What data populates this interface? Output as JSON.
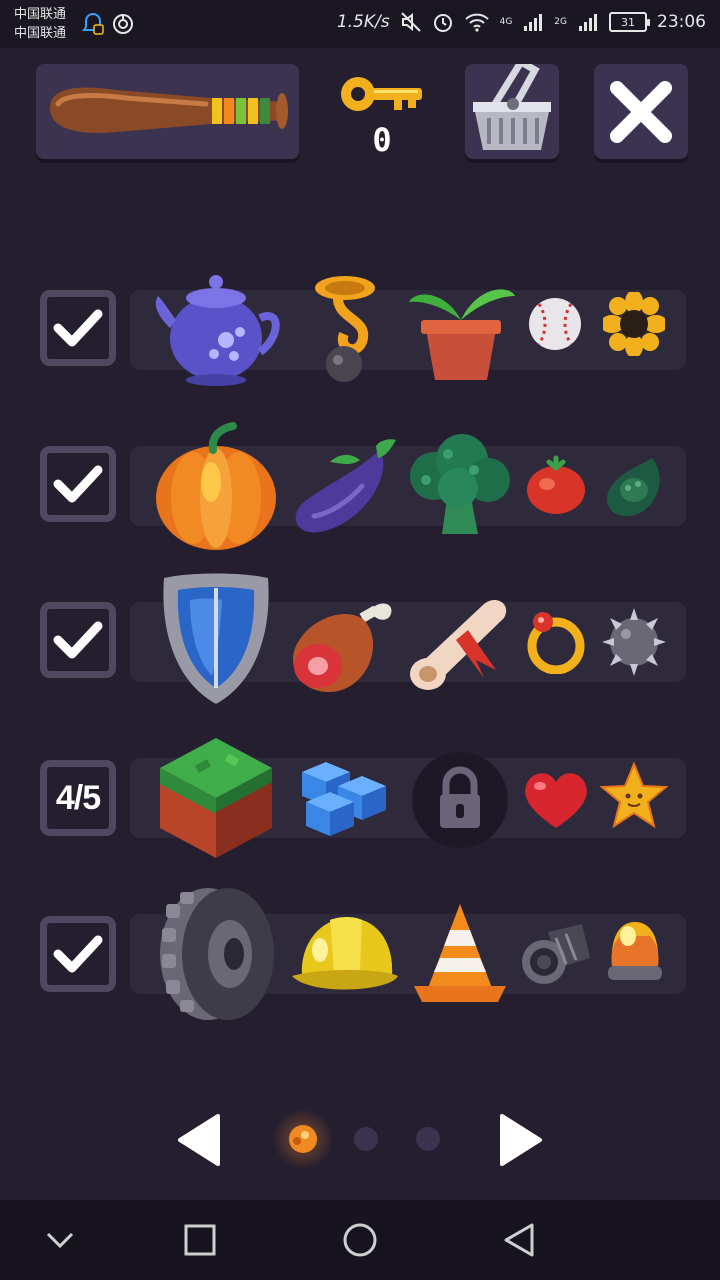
{
  "status_bar": {
    "carrier_1": "中国联通",
    "carrier_2": "中国联通",
    "speed": "1.5K/s",
    "network_1": "4G",
    "network_2": "2G",
    "battery": "31",
    "time": "23:06",
    "icons": [
      "notification-icon",
      "app-icon",
      "mute-icon",
      "alarm-icon",
      "wifi-icon",
      "signal-icon",
      "battery-icon"
    ]
  },
  "top_bar": {
    "weapon": "baseball-bat-icon",
    "key_count": "0",
    "basket": "basket-icon",
    "close": "close-icon"
  },
  "rows": [
    {
      "status": "checked",
      "items": [
        "teapot-icon",
        "tuba-icon",
        "plant-pot-icon",
        "baseball-icon",
        "sunflower-icon"
      ]
    },
    {
      "status": "checked",
      "items": [
        "pumpkin-icon",
        "eggplant-icon",
        "broccoli-icon",
        "tomato-icon",
        "avocado-icon"
      ]
    },
    {
      "status": "checked",
      "items": [
        "shield-icon",
        "ham-icon",
        "scroll-icon",
        "ring-icon",
        "spiked-ball-icon"
      ]
    },
    {
      "status": "count",
      "count": "4/5",
      "items": [
        "grass-block-icon",
        "blue-cubes-icon",
        "lock-icon",
        "heart-icon",
        "star-icon"
      ]
    },
    {
      "status": "checked",
      "items": [
        "tire-icon",
        "hard-hat-icon",
        "traffic-cone-icon",
        "camera-lens-icon",
        "siren-icon"
      ]
    }
  ],
  "pager": {
    "current_page": 1,
    "total_pages": 3
  },
  "colors": {
    "background": "#241e2f",
    "panel": "#3b3350",
    "row_bar": "#2f293c",
    "checkbox_border": "#4f4861",
    "active_dot": "#f08a24"
  }
}
